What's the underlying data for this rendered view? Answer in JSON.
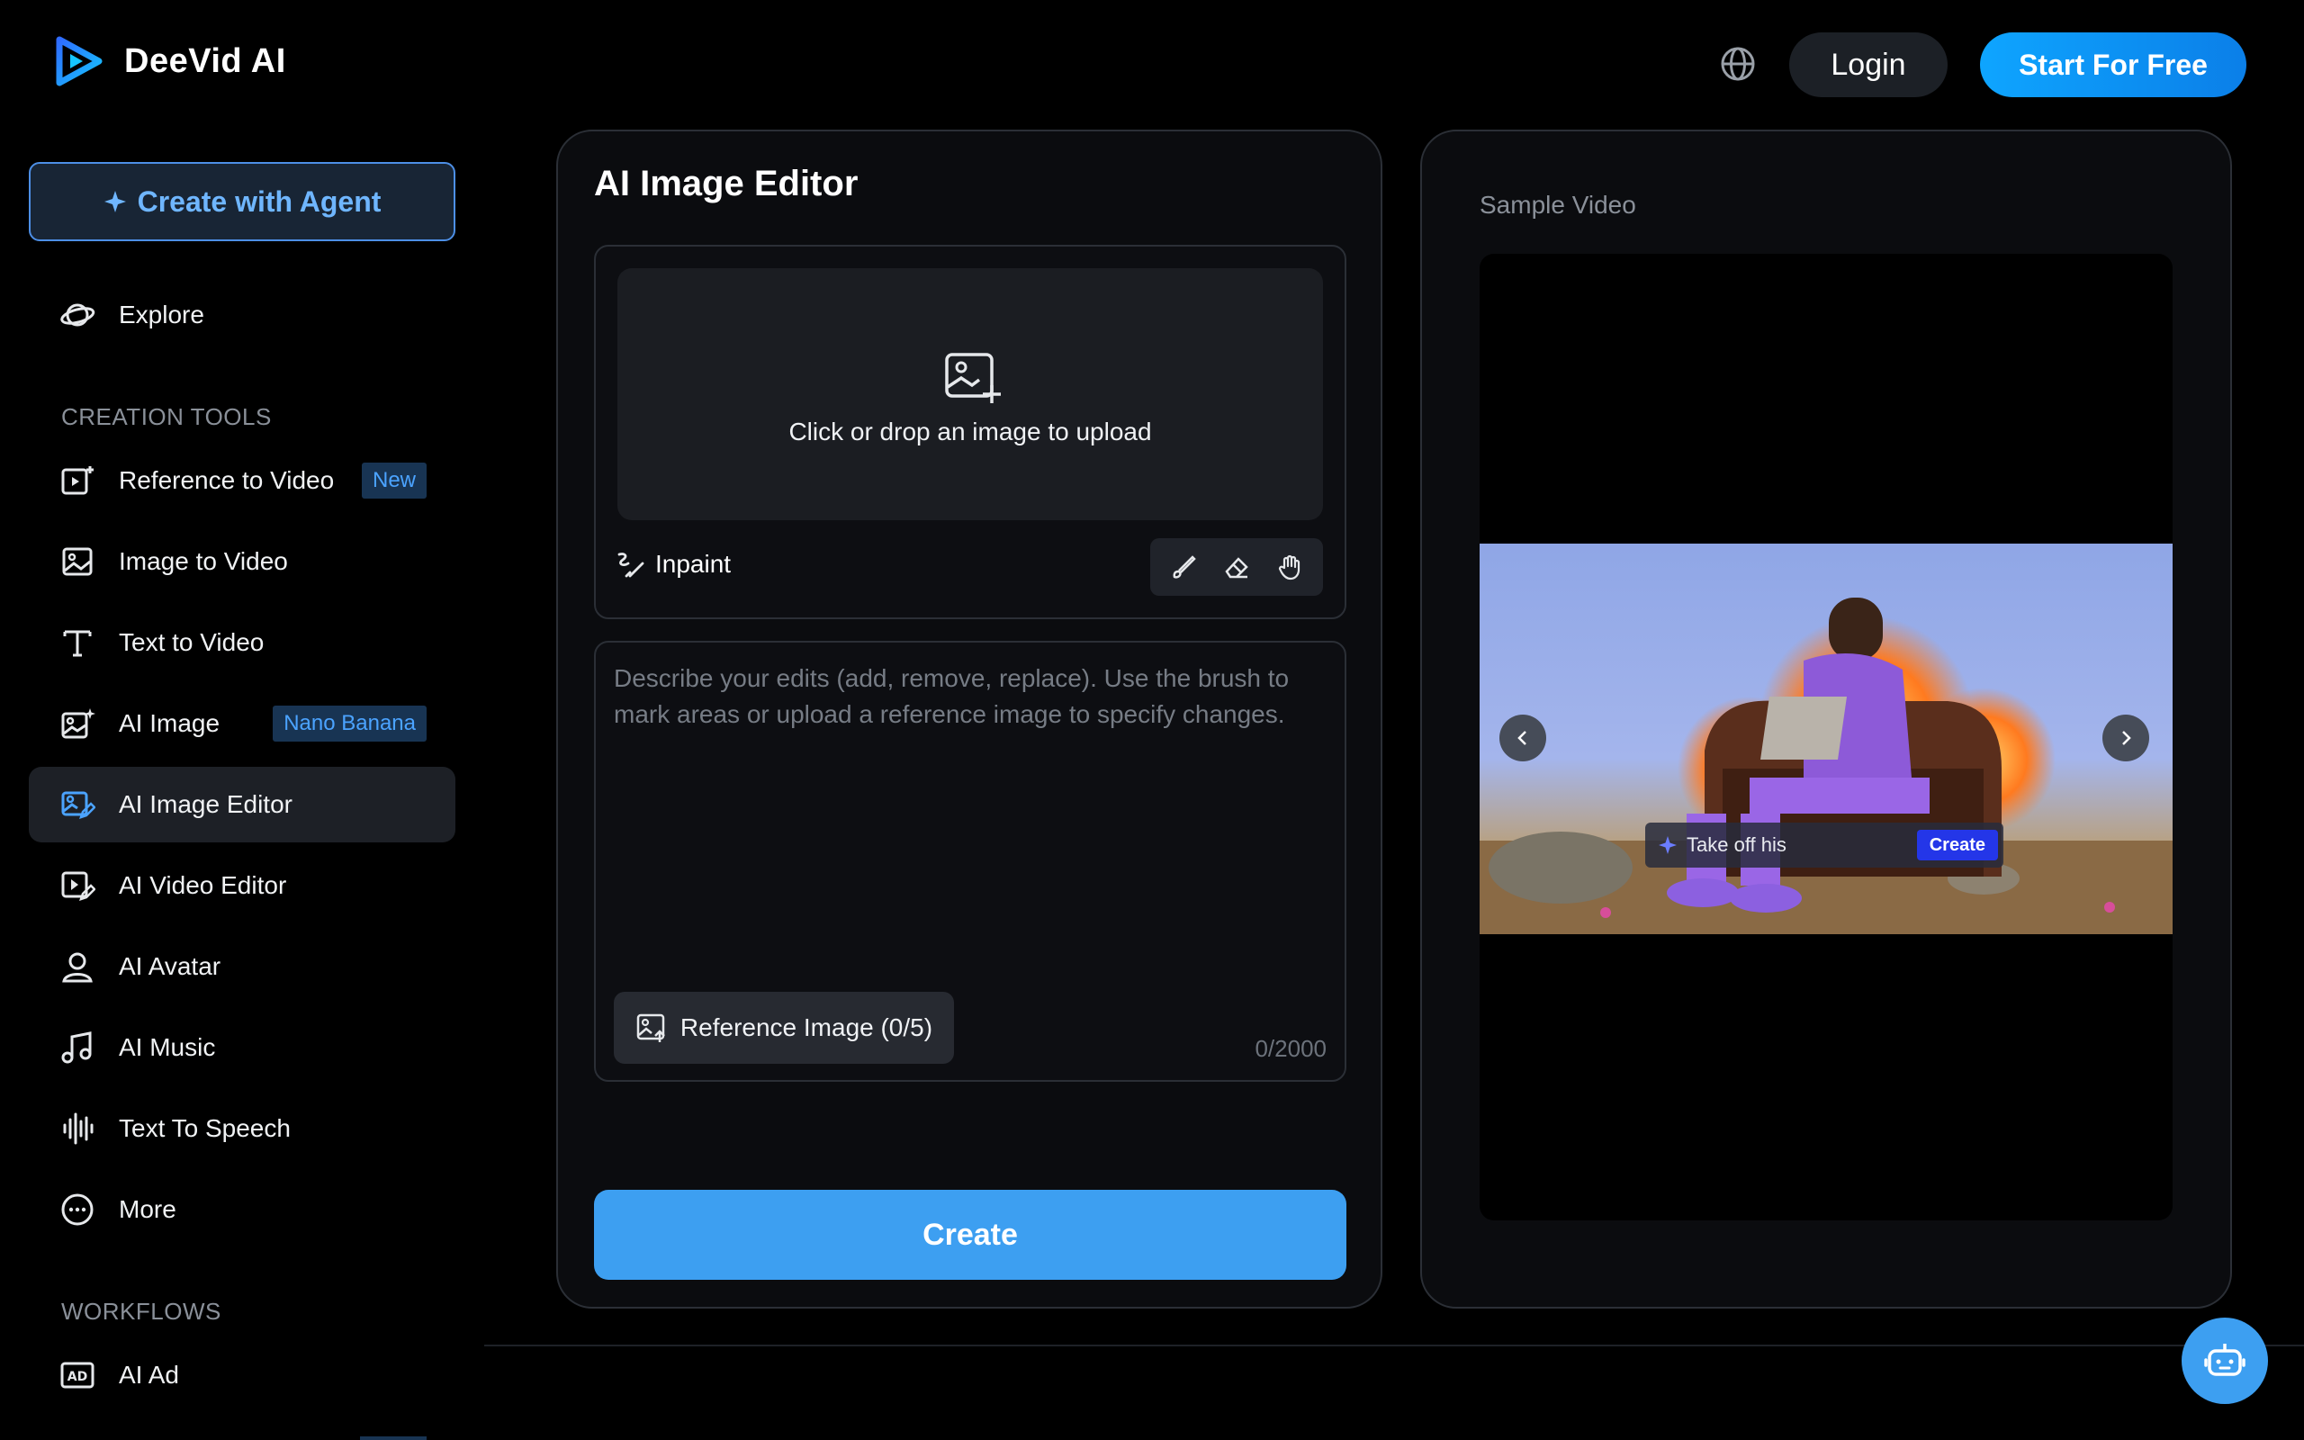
{
  "header": {
    "brand": "DeeVid AI",
    "login": "Login",
    "start": "Start For Free"
  },
  "sidebar": {
    "agent_button": "Create with Agent",
    "explore": "Explore",
    "creation_tools_label": "CREATION TOOLS",
    "items": [
      {
        "label": "Reference to Video",
        "badge": "New",
        "icon": "video-plus-icon"
      },
      {
        "label": "Image to Video",
        "icon": "image-icon"
      },
      {
        "label": "Text to Video",
        "icon": "text-icon"
      },
      {
        "label": "AI Image",
        "badge": "Nano Banana",
        "icon": "image-sparkle-icon"
      },
      {
        "label": "AI Image Editor",
        "icon": "image-edit-icon"
      },
      {
        "label": "AI Video Editor",
        "icon": "video-edit-icon"
      },
      {
        "label": "AI Avatar",
        "icon": "avatar-icon"
      },
      {
        "label": "AI Music",
        "icon": "music-icon"
      },
      {
        "label": "Text To Speech",
        "icon": "waveform-icon"
      },
      {
        "label": "More",
        "icon": "more-icon"
      }
    ],
    "workflows_label": "WORKFLOWS",
    "workflow_items": [
      {
        "label": "AI Ad",
        "icon": "ad-icon"
      }
    ]
  },
  "editor": {
    "title": "AI Image Editor",
    "upload_text": "Click or drop an image to upload",
    "inpaint_label": "Inpaint",
    "prompt_placeholder": "Describe your edits (add, remove, replace). Use the brush to mark areas or upload a reference image to specify changes.",
    "reference_button": "Reference Image (0/5)",
    "counter": "0/2000",
    "create_button": "Create"
  },
  "sample": {
    "label": "Sample Video",
    "overlay_text": "Take off his",
    "overlay_button": "Create"
  },
  "colors": {
    "accent": "#3d9ff1",
    "badge_bg": "#183453",
    "badge_text": "#4ba3ff",
    "panel_border": "#2b2f36"
  }
}
